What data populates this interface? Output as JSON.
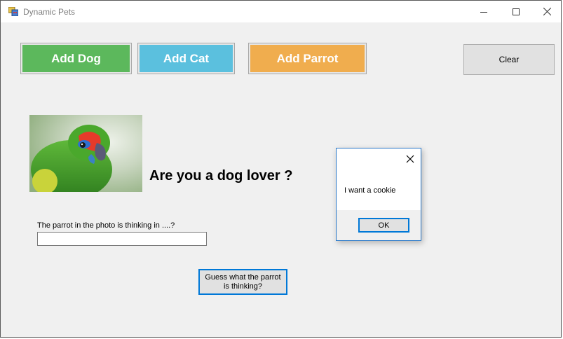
{
  "window": {
    "title": "Dynamic Pets"
  },
  "toolbar": {
    "add_dog": "Add Dog",
    "add_cat": "Add Cat",
    "add_parrot": "Add Parrot",
    "clear": "Clear"
  },
  "colors": {
    "dog": "#5cb85c",
    "cat": "#5bc0de",
    "parrot": "#f0ad4e",
    "focus": "#0078d7"
  },
  "main": {
    "question": "Are you a dog lover ?",
    "prompt": "The parrot in the photo is thinking in ....?",
    "answer_value": "",
    "guess_button": "Guess what the parrot is thinking?",
    "photo_icon": "parrot-photo"
  },
  "dialog": {
    "message": "I want a cookie",
    "ok": "OK"
  }
}
